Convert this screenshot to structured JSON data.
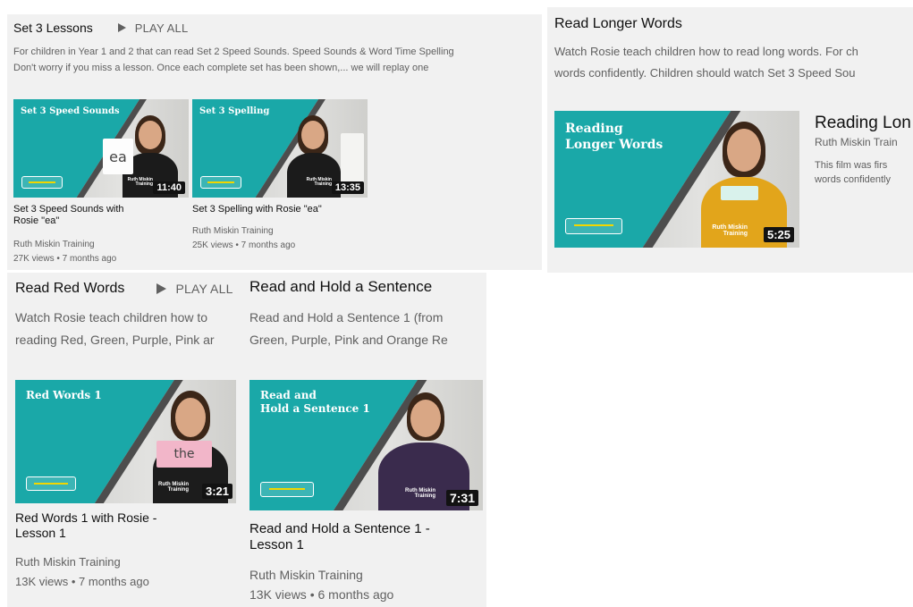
{
  "sections": {
    "set3": {
      "title": "Set 3 Lessons",
      "play_all": "PLAY ALL",
      "desc_line1": "For children in Year 1 and 2 that can read Set 2 Speed Sounds. Speed Sounds & Word Time Spelling",
      "desc_line2": "Don't worry if you miss a lesson. Once each complete set has been shown,... we will replay one",
      "videos": [
        {
          "thumb_title": "Set 3 Speed Sounds",
          "card_text": "ea",
          "brand": "Ruth Miskin Training",
          "duration": "11:40",
          "title_line1": "Set 3 Speed Sounds with",
          "title_line2": "Rosie \"ea\"",
          "channel": "Ruth Miskin Training",
          "meta": "27K views • 7 months ago"
        },
        {
          "thumb_title": "Set 3 Spelling",
          "card_text": "",
          "brand": "Ruth Miskin Training",
          "duration": "13:35",
          "title_line1": "Set 3 Spelling with Rosie \"ea\"",
          "title_line2": "",
          "channel": "Ruth Miskin Training",
          "meta": "25K views • 7 months ago"
        }
      ]
    },
    "longer": {
      "title": "Read Longer Words",
      "desc_line1": "Watch Rosie teach children how to read long words. For ch",
      "desc_line2": "words confidently. Children should watch Set 3 Speed Sou",
      "video": {
        "thumb_title_line1": "Reading",
        "thumb_title_line2": "Longer Words",
        "card_text": "",
        "brand": "Ruth Miskin Training",
        "duration": "5:25",
        "title": "Reading Lon",
        "channel": "Ruth Miskin Train",
        "desc_line1": "This film was firs",
        "desc_line2": "words confidently"
      }
    },
    "red": {
      "title": "Read Red Words",
      "play_all": "PLAY ALL",
      "desc_line1": "Watch Rosie teach children how to",
      "desc_line2": "reading Red, Green, Purple, Pink ar",
      "video": {
        "thumb_title": "Red Words 1",
        "card_text": "the",
        "brand": "Ruth Miskin Training",
        "duration": "3:21",
        "title_line1": "Red Words 1 with Rosie -",
        "title_line2": "Lesson 1",
        "channel": "Ruth Miskin Training",
        "meta": "13K views • 7 months ago"
      }
    },
    "hold": {
      "title": "Read and Hold a Sentence",
      "desc_line1": "Read and Hold a Sentence 1 (from",
      "desc_line2": "Green, Purple, Pink and Orange Re",
      "video": {
        "thumb_title_line1": "Read and",
        "thumb_title_line2": "Hold a Sentence 1",
        "brand": "Ruth Miskin Training",
        "duration": "7:31",
        "title_line1": "Read and Hold a Sentence 1 -",
        "title_line2": "Lesson 1",
        "channel": "Ruth Miskin Training",
        "meta": "13K views • 6 months ago"
      }
    }
  },
  "icons": {
    "play_all": "play-triangle-icon"
  },
  "colors": {
    "teal": "#1aa8a8",
    "panel_bg": "#f1f1f1",
    "muted_text": "#606060",
    "duration_bg": "#121212"
  }
}
